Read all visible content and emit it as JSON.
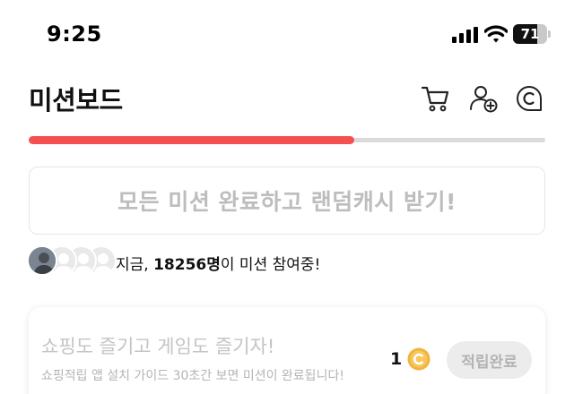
{
  "status_bar": {
    "time": "9:25",
    "battery_level": "71",
    "battery_fraction": 0.71,
    "icons": [
      "signal-icon",
      "wifi-icon",
      "battery-icon"
    ]
  },
  "header": {
    "title": "미션보드",
    "icons": [
      "cart-icon",
      "add-friend-icon",
      "cash-icon"
    ]
  },
  "progress": {
    "fraction": 0.63,
    "color": "#f4504f"
  },
  "reward_banner": {
    "text": "모든 미션 완료하고 랜덤캐시 받기!"
  },
  "participants": {
    "prefix": "지금, ",
    "count": "18256명",
    "suffix": "이 미션 참여중!"
  },
  "mission": {
    "title": "쇼핑도 즐기고 게임도 즐기자!",
    "description": "쇼핑적립 앱 설치 가이드 30초간 보면 미션이 완료됩니다!",
    "reward_count": "1",
    "reward_icon": "coin-icon",
    "button_label": "적립완료"
  },
  "colors": {
    "accent": "#f4504f",
    "coin": "#f2b33d",
    "muted_text": "#c4c4c4"
  }
}
